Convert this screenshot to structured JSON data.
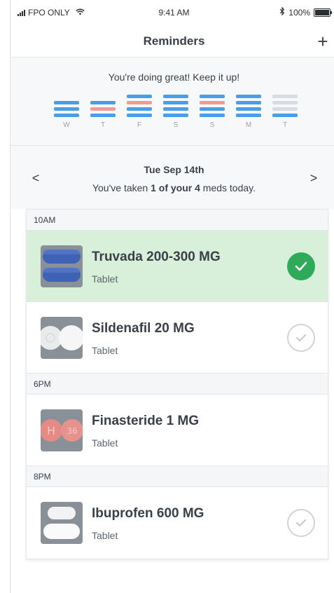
{
  "status_bar": {
    "carrier": "FPO ONLY",
    "time": "9:41 AM",
    "battery": "100%"
  },
  "header": {
    "title": "Reminders",
    "add_label": "+"
  },
  "streak": {
    "message": "You're doing great! Keep it up!",
    "days": [
      {
        "label": "W",
        "bars": [
          "blue",
          "blue",
          "blue"
        ]
      },
      {
        "label": "T",
        "bars": [
          "blue",
          "red",
          "blue"
        ]
      },
      {
        "label": "F",
        "bars": [
          "blue",
          "red",
          "blue",
          "blue"
        ]
      },
      {
        "label": "S",
        "bars": [
          "blue",
          "blue",
          "blue",
          "blue"
        ]
      },
      {
        "label": "S",
        "bars": [
          "blue",
          "red",
          "blue",
          "blue"
        ]
      },
      {
        "label": "M",
        "bars": [
          "blue",
          "blue",
          "blue",
          "blue"
        ]
      },
      {
        "label": "T",
        "bars": [
          "gray",
          "gray",
          "gray",
          "blue"
        ]
      }
    ]
  },
  "date_nav": {
    "prev": "<",
    "next": ">",
    "date": "Tue Sep 14th",
    "summary_prefix": "You've taken ",
    "summary_bold": "1 of your 4",
    "summary_suffix": " meds today."
  },
  "colors": {
    "taken_bg": "#d8efd9",
    "check_green": "#2eaa5a",
    "bar_blue": "#4a9ee8",
    "bar_red": "#ee9c94",
    "bar_gray": "#d8dce0"
  },
  "sections": [
    {
      "time": "10AM",
      "meds": [
        {
          "name": "Truvada 200-300 MG",
          "form": "Tablet",
          "taken": true,
          "pill": "blue-oblong"
        },
        {
          "name": "Sildenafil 20 MG",
          "form": "Tablet",
          "taken": false,
          "pill": "white-round"
        }
      ]
    },
    {
      "time": "6PM",
      "meds": [
        {
          "name": "Finasteride 1 MG",
          "form": "Tablet",
          "taken": false,
          "pill": "pink-round",
          "pill_marks": [
            "H",
            "36"
          ]
        }
      ]
    },
    {
      "time": "8PM",
      "meds": [
        {
          "name": "Ibuprofen 600 MG",
          "form": "Tablet",
          "taken": false,
          "pill": "white-oblong"
        }
      ]
    }
  ]
}
